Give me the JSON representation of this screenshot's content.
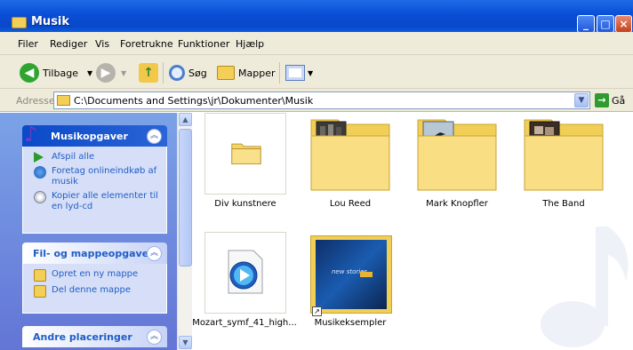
{
  "window": {
    "title": "Musik"
  },
  "menu": [
    "Filer",
    "Rediger",
    "Vis",
    "Foretrukne",
    "Funktioner",
    "Hjælp"
  ],
  "toolbar": {
    "back": "Tilbage",
    "search": "Søg",
    "folders": "Mapper"
  },
  "address": {
    "label": "Adresse",
    "path": "C:\\Documents and Settings\\jr\\Dokumenter\\Musik",
    "go": "Gå"
  },
  "tasks": {
    "music": {
      "title": "Musikopgaver",
      "items": [
        "Afspil alle",
        "Foretag onlineindkøb af musik",
        "Kopier alle elementer til en lyd-cd"
      ]
    },
    "files": {
      "title": "Fil- og mappeopgaver",
      "items": [
        "Opret en ny mappe",
        "Del denne mappe"
      ]
    },
    "other": {
      "title": "Andre placeringer"
    }
  },
  "items": [
    {
      "name": "Div kunstnere",
      "kind": "folder"
    },
    {
      "name": "Lou Reed",
      "kind": "album-folder"
    },
    {
      "name": "Mark Knopfler",
      "kind": "album-folder"
    },
    {
      "name": "The Band",
      "kind": "album-folder"
    },
    {
      "name": "Mozart_symf_41_high...",
      "kind": "media-file"
    },
    {
      "name": "Musikeksempler",
      "kind": "shortcut",
      "art_text": "new stories"
    }
  ],
  "colors": {
    "titlebar": "#0a4ed6",
    "taskpane": "#6e8fe0",
    "folder": "#f8d86a"
  }
}
